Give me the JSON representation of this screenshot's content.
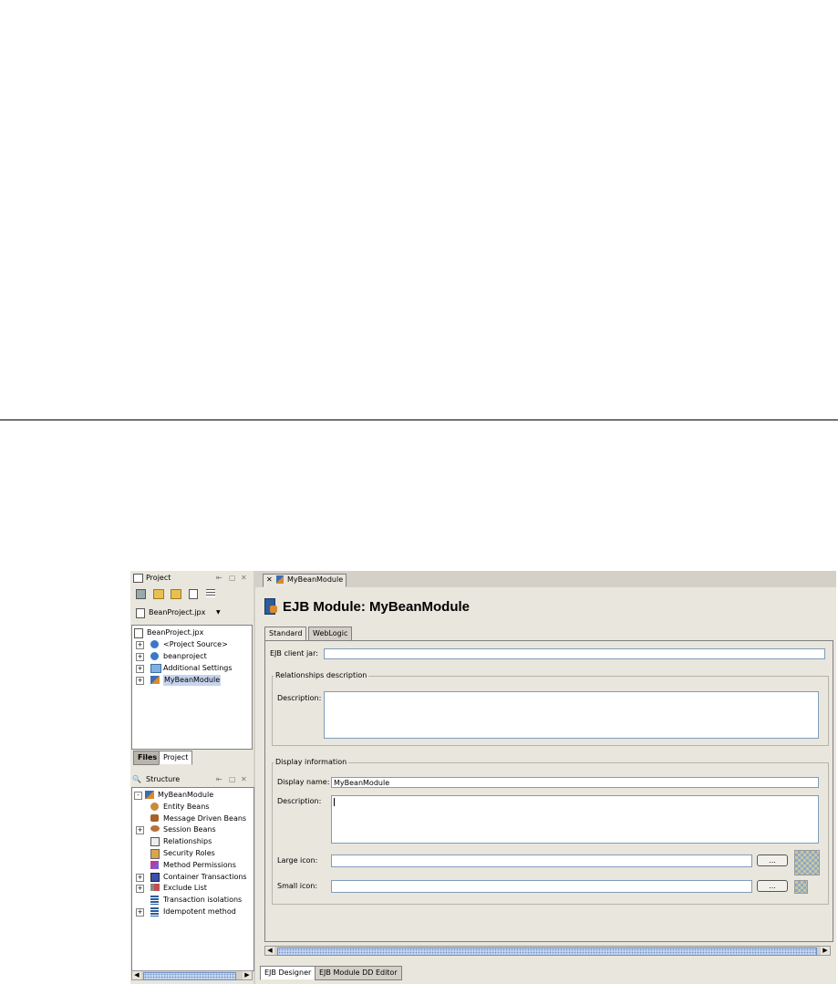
{
  "project_panel": {
    "title": "Project",
    "project_selector": "BeanProject.jpx",
    "tree": [
      {
        "label": "BeanProject.jpx",
        "icon": "project-file-icon",
        "indent": 0,
        "expander": ""
      },
      {
        "label": "<Project Source>",
        "icon": "source-package-icon",
        "indent": 1,
        "expander": "+"
      },
      {
        "label": "beanproject",
        "icon": "package-icon",
        "indent": 1,
        "expander": "+"
      },
      {
        "label": "Additional Settings",
        "icon": "folder-icon",
        "indent": 1,
        "expander": "+"
      },
      {
        "label": "MyBeanModule",
        "icon": "ejb-module-icon",
        "indent": 1,
        "expander": "+",
        "selected": true
      }
    ],
    "tabs": [
      "Files",
      "Project"
    ],
    "active_tab": "Project"
  },
  "structure_panel": {
    "title": "Structure",
    "tree": [
      {
        "label": "MyBeanModule",
        "icon": "ejb-module-icon",
        "indent": 0,
        "expander": "-"
      },
      {
        "label": "Entity Beans",
        "icon": "entity-beans-icon",
        "indent": 1,
        "expander": ""
      },
      {
        "label": "Message Driven Beans",
        "icon": "message-beans-icon",
        "indent": 1,
        "expander": ""
      },
      {
        "label": "Session Beans",
        "icon": "session-beans-icon",
        "indent": 1,
        "expander": "+"
      },
      {
        "label": "Relationships",
        "icon": "relationships-icon",
        "indent": 1,
        "expander": ""
      },
      {
        "label": "Security Roles",
        "icon": "security-roles-icon",
        "indent": 1,
        "expander": ""
      },
      {
        "label": "Method Permissions",
        "icon": "method-permissions-icon",
        "indent": 1,
        "expander": ""
      },
      {
        "label": "Container Transactions",
        "icon": "container-transactions-icon",
        "indent": 1,
        "expander": "+"
      },
      {
        "label": "Exclude List",
        "icon": "exclude-list-icon",
        "indent": 1,
        "expander": "+"
      },
      {
        "label": "Transaction isolations",
        "icon": "transaction-isolations-icon",
        "indent": 1,
        "expander": ""
      },
      {
        "label": "Idempotent method",
        "icon": "idempotent-method-icon",
        "indent": 1,
        "expander": "+"
      }
    ]
  },
  "editor": {
    "doc_tab": "MyBeanModule",
    "heading": "EJB Module: MyBeanModule",
    "tabs": [
      "Standard",
      "WebLogic"
    ],
    "active_tab": "Standard",
    "ejb_client_jar_label": "EJB client jar:",
    "ejb_client_jar_value": "",
    "relationships_group": "Relationships description",
    "rel_description_label": "Description:",
    "rel_description_value": "",
    "display_group": "Display information",
    "display_name_label": "Display name:",
    "display_name_value": "MyBeanModule",
    "display_description_label": "Description:",
    "display_description_value": "",
    "large_icon_label": "Large icon:",
    "large_icon_value": "",
    "small_icon_label": "Small icon:",
    "small_icon_value": "",
    "browse_button": "...",
    "bottom_tabs": [
      "EJB Designer",
      "EJB Module DD Editor"
    ],
    "active_bottom_tab": "EJB Designer"
  },
  "colors": {
    "selection": "#c7d4ee",
    "panel_bg": "#e9e6dd",
    "app_bg": "#d4d0c8"
  }
}
